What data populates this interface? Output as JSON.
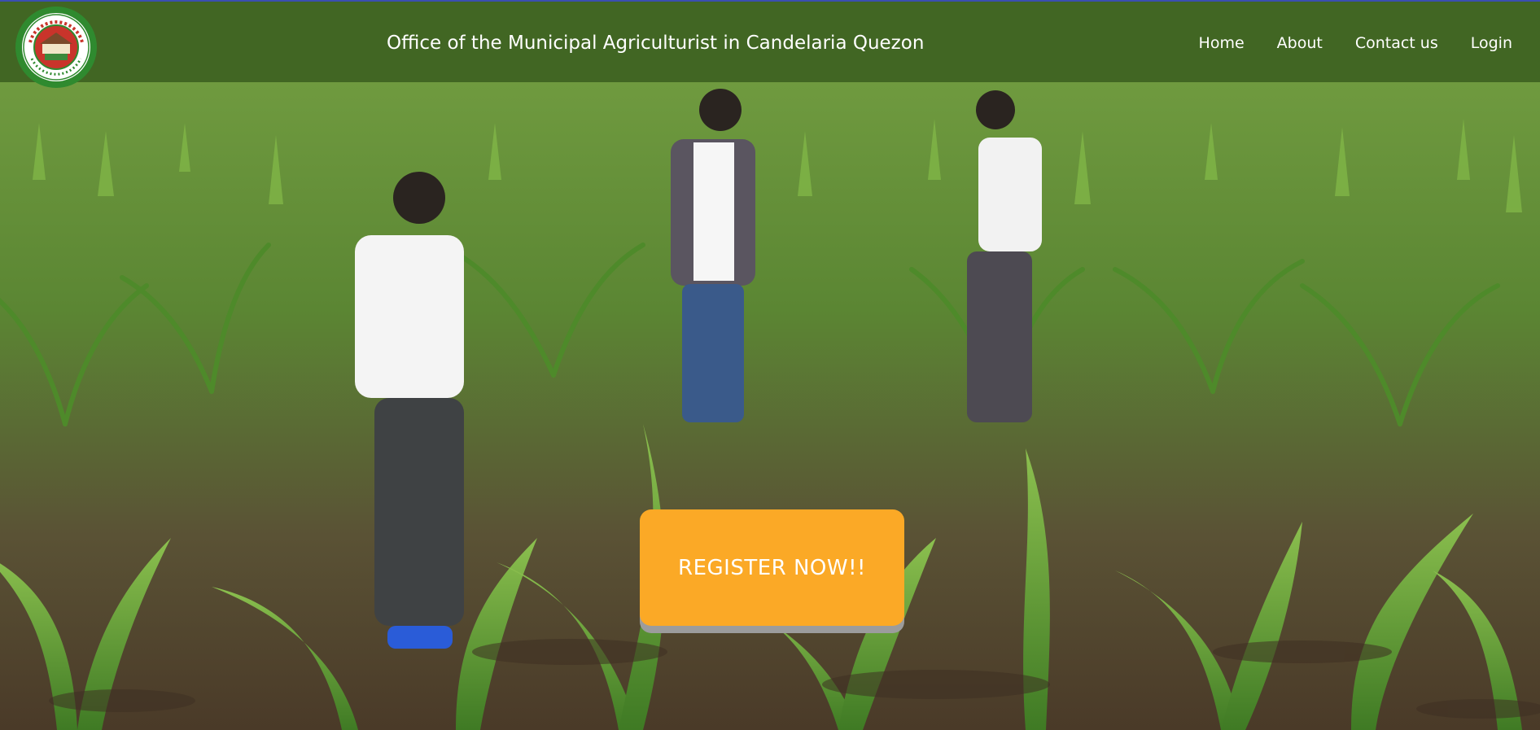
{
  "header": {
    "logo_text": "OFFICIAL SEAL",
    "title": "Office of the Municipal Agriculturist in Candelaria Quezon",
    "nav": [
      {
        "label": "Home"
      },
      {
        "label": "About"
      },
      {
        "label": "Contact us"
      },
      {
        "label": "Login"
      }
    ]
  },
  "hero": {
    "image_alt": "Corn field with three people using mobile phones",
    "cta_label": "REGISTER NOW!!"
  },
  "colors": {
    "navbar": "#416623",
    "cta": "#fba926",
    "cta_shadow": "#9c9c9c"
  }
}
